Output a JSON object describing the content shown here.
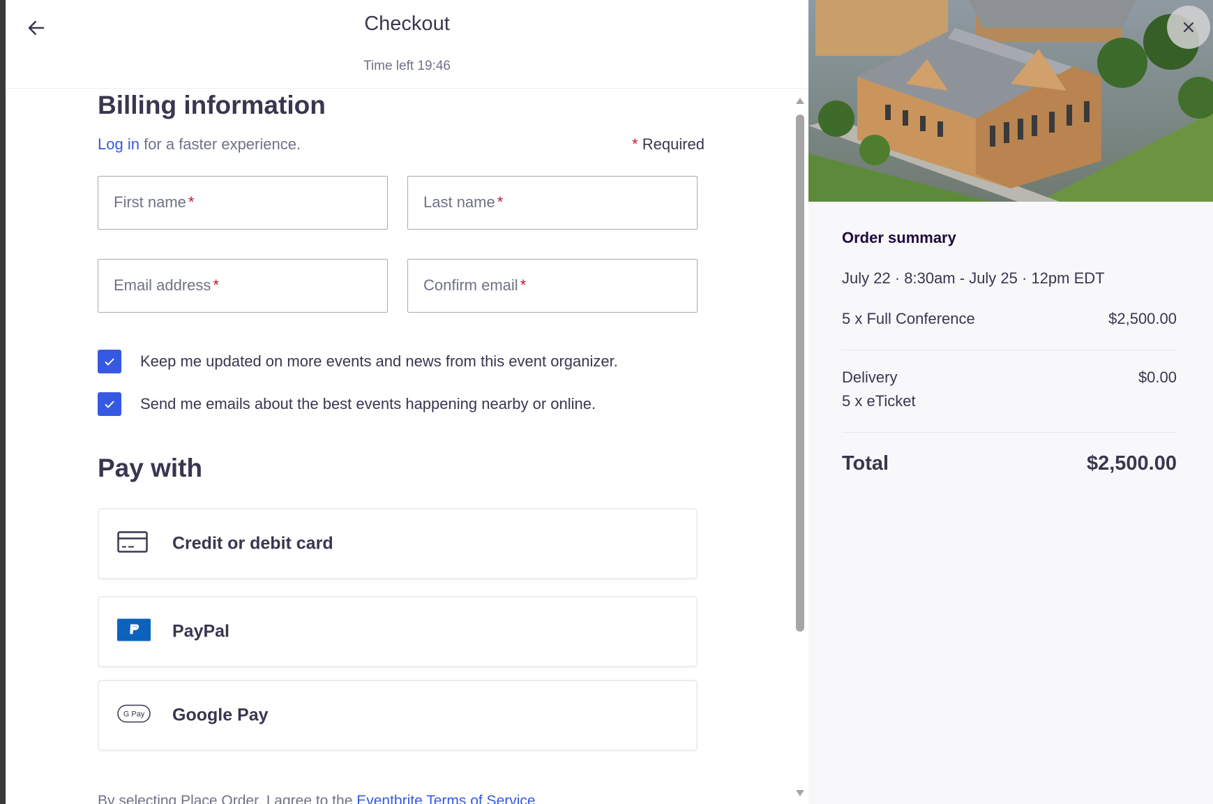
{
  "header": {
    "title": "Checkout",
    "time_left": "Time left 19:46"
  },
  "billing": {
    "heading": "Billing information",
    "login_link": "Log in",
    "login_suffix": " for a faster experience.",
    "required_star": "*",
    "required_label": " Required",
    "fields": {
      "first_name": {
        "placeholder": "First name",
        "value": ""
      },
      "last_name": {
        "placeholder": "Last name",
        "value": ""
      },
      "email": {
        "placeholder": "Email address",
        "value": ""
      },
      "confirm_email": {
        "placeholder": "Confirm email",
        "value": ""
      }
    },
    "required_marker": "*",
    "checkboxes": [
      {
        "label": "Keep me updated on more events and news from this event organizer.",
        "checked": true
      },
      {
        "label": "Send me emails about the best events happening nearby or online.",
        "checked": true
      }
    ]
  },
  "payment": {
    "heading": "Pay with",
    "options": [
      {
        "label": "Credit or debit card",
        "icon": "credit-card-icon"
      },
      {
        "label": "PayPal",
        "icon": "paypal-icon"
      },
      {
        "label": "Google Pay",
        "icon": "google-pay-icon"
      }
    ],
    "gpay_icon_text": "G Pay"
  },
  "terms": {
    "prefix": "By selecting Place Order, I agree to the ",
    "link": "Eventbrite Terms of Service"
  },
  "order_summary": {
    "title": "Order summary",
    "date": "July 22 · 8:30am - July 25 · 12pm EDT",
    "ticket_line": "5 x Full Conference",
    "ticket_amount": "$2,500.00",
    "delivery_label": "Delivery",
    "delivery_amount": "$0.00",
    "delivery_detail": "5 x eTicket",
    "total_label": "Total",
    "total_amount": "$2,500.00"
  },
  "colors": {
    "accent": "#3659e3",
    "required": "#c5162e",
    "text": "#39364f",
    "muted": "#6f7287"
  }
}
